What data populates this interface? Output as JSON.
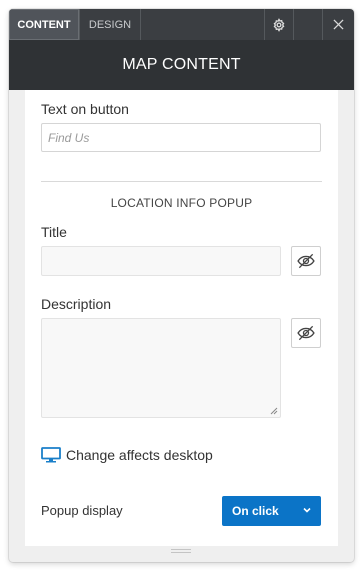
{
  "tabs": [
    {
      "label": "CONTENT",
      "active": true
    },
    {
      "label": "DESIGN",
      "active": false
    }
  ],
  "toolbar": {
    "settings_icon": "gear-icon",
    "close_icon": "close-icon"
  },
  "header": {
    "title": "MAP CONTENT"
  },
  "button_text": {
    "label": "Text on button",
    "placeholder": "Find Us",
    "value": ""
  },
  "location_popup": {
    "section_title": "LOCATION INFO POPUP",
    "title": {
      "label": "Title",
      "value": "",
      "visibility_icon": "eye-off-icon"
    },
    "description": {
      "label": "Description",
      "value": "",
      "visibility_icon": "eye-off-icon"
    }
  },
  "device_notice": {
    "icon": "desktop-icon",
    "text": "Change affects desktop",
    "icon_color": "#1a7fc9"
  },
  "popup_display": {
    "label": "Popup display",
    "selected": "On click",
    "accent": "#0b74c7"
  }
}
